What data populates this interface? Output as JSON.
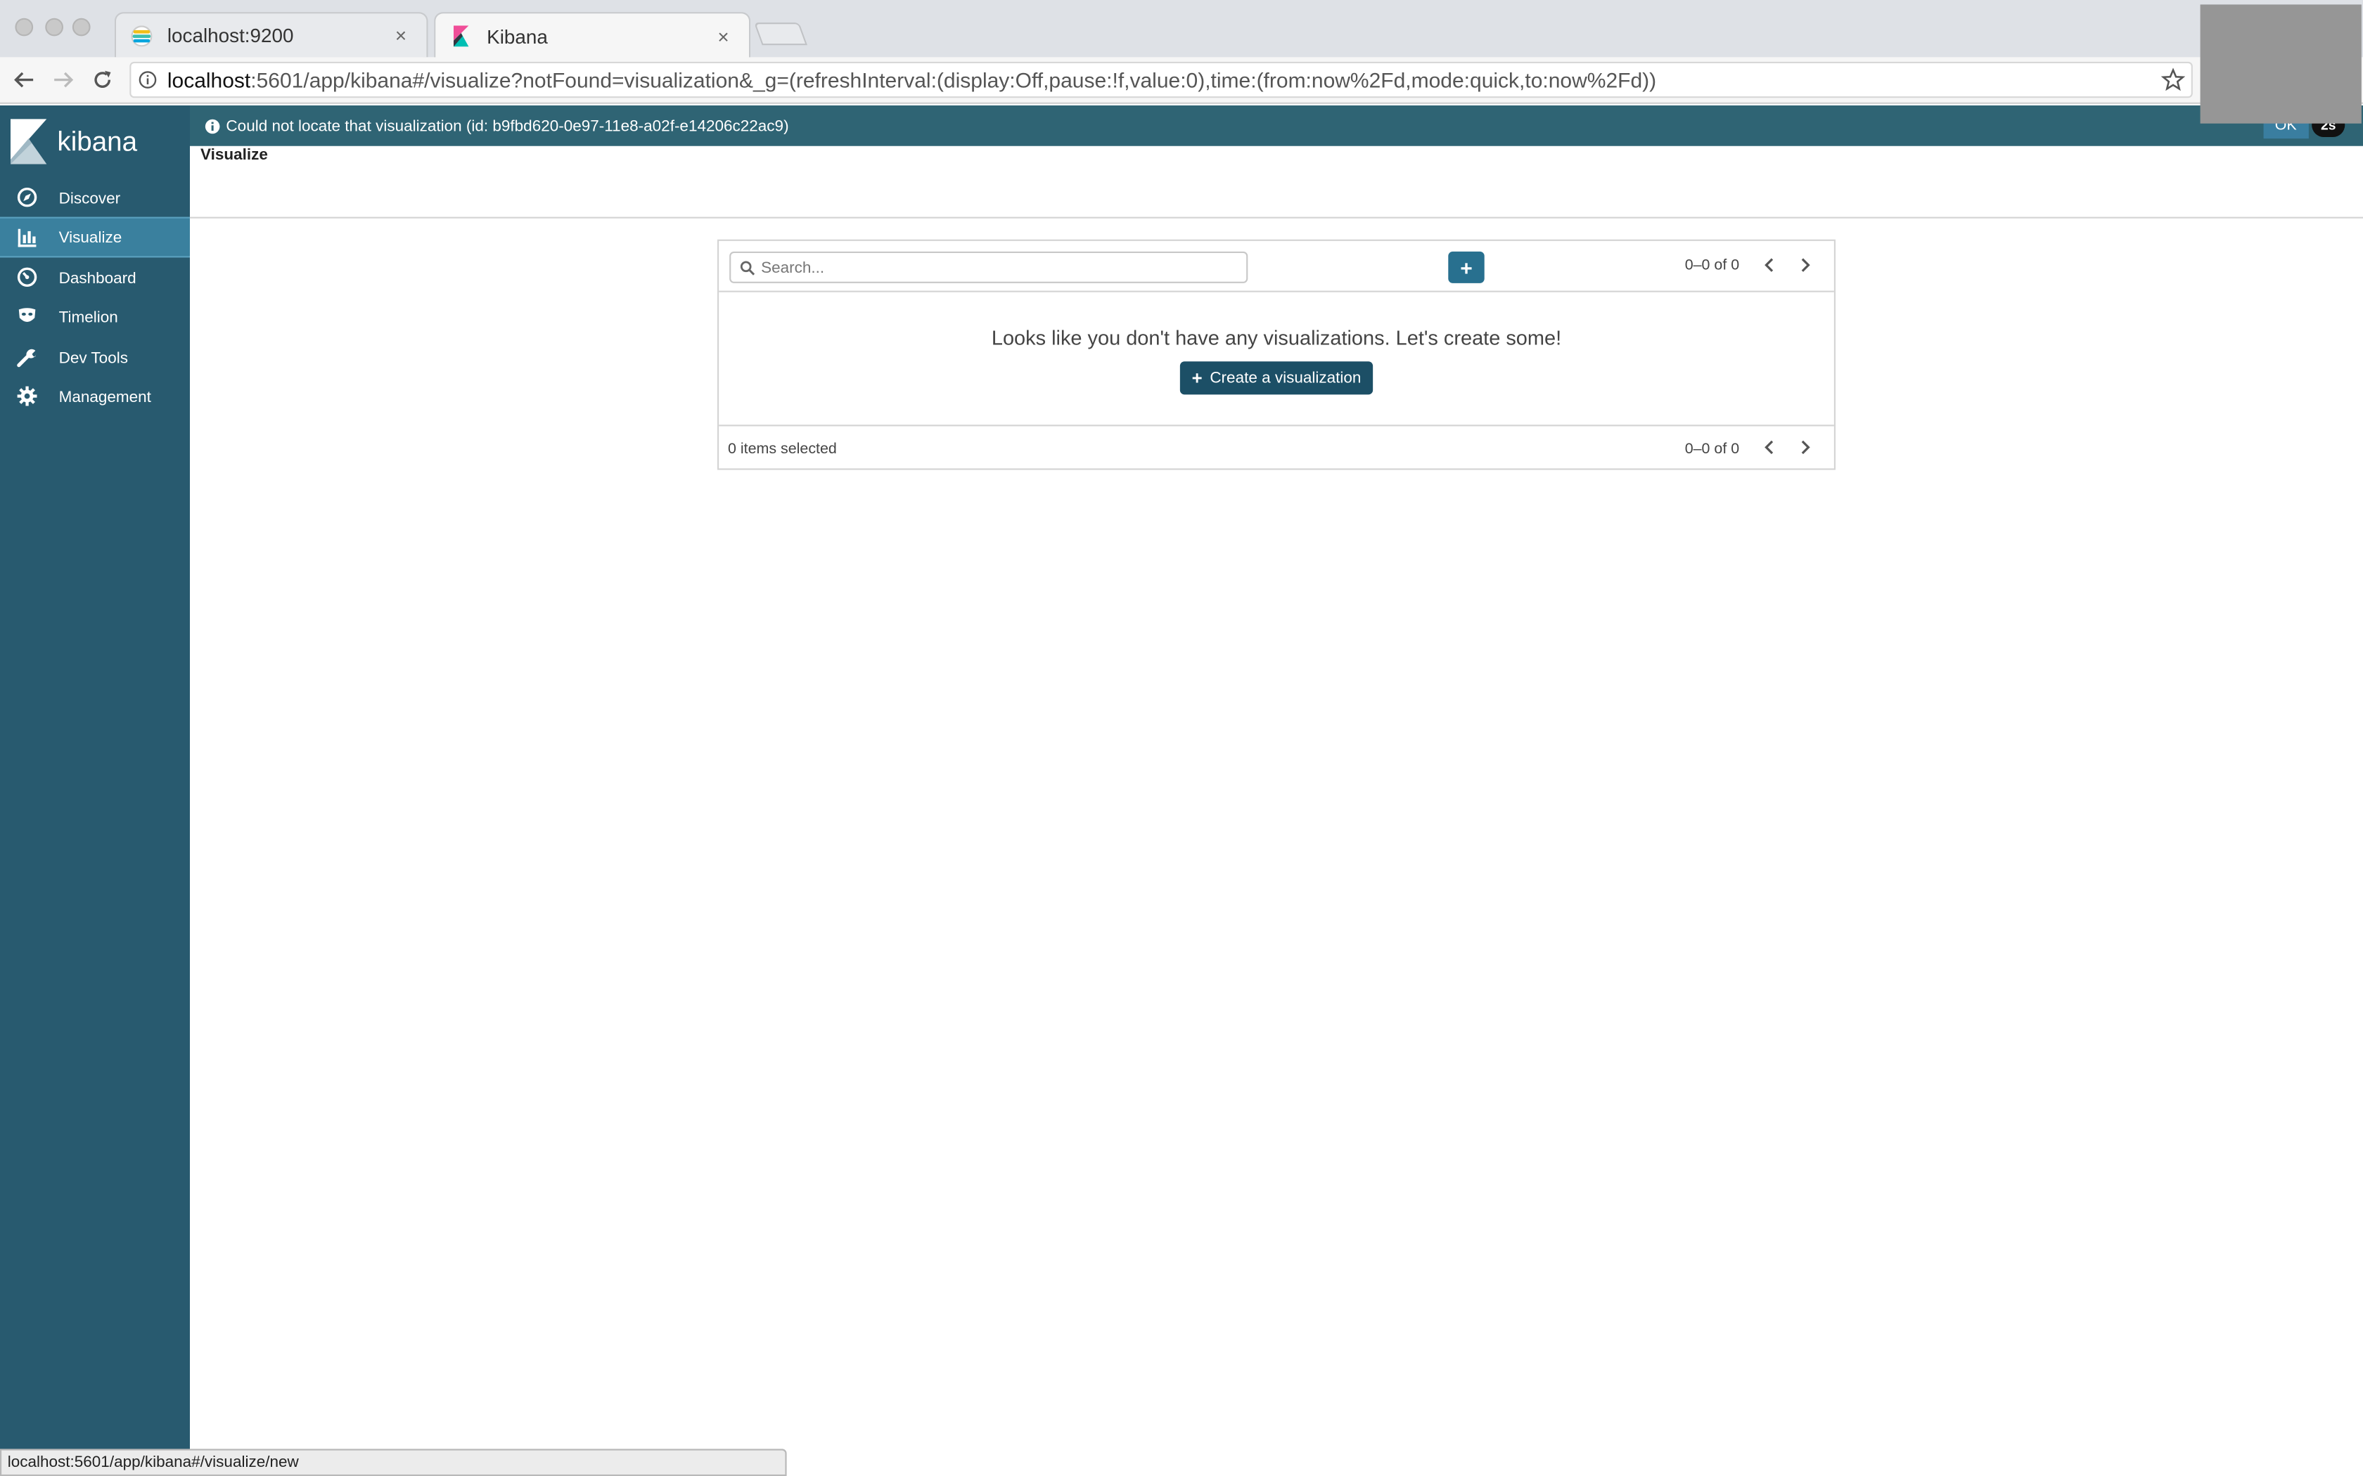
{
  "browser": {
    "tabs": [
      {
        "title": "localhost:9200",
        "close": "×",
        "favicon": "elasticsearch-favicon-icon"
      },
      {
        "title": "Kibana",
        "close": "×",
        "favicon": "kibana-favicon-icon"
      }
    ],
    "url": {
      "host": "localhost",
      "path": ":5601/app/kibana#/visualize?notFound=visualization&_g=(refreshInterval:(display:Off,pause:!f,value:0),time:(from:now%2Fd,mode:quick,to:now%2Fd))"
    },
    "status_url": "localhost:5601/app/kibana#/visualize/new"
  },
  "sidebar": {
    "logo_text": "kibana",
    "items": [
      {
        "label": "Discover",
        "icon": "compass-icon"
      },
      {
        "label": "Visualize",
        "icon": "bar-chart-icon",
        "active": true
      },
      {
        "label": "Dashboard",
        "icon": "dashboard-gauge-icon"
      },
      {
        "label": "Timelion",
        "icon": "timelion-mask-icon"
      },
      {
        "label": "Dev Tools",
        "icon": "wrench-icon"
      },
      {
        "label": "Management",
        "icon": "gear-icon"
      }
    ]
  },
  "notification": {
    "message": "Could not locate that visualization (id: b9fbd620-0e97-11e8-a02f-e14206c22ac9)",
    "ok_label": "OK",
    "count": "2s"
  },
  "page": {
    "title": "Visualize"
  },
  "list": {
    "search_placeholder": "Search...",
    "add_label": "+",
    "pager_top": "0–0 of 0",
    "empty_message": "Looks like you don't have any visualizations. Let's create some!",
    "create_label": "Create a visualization",
    "selected_text": "0 items selected",
    "pager_bottom": "0–0 of 0"
  },
  "colors": {
    "sidebar": "#285a6f",
    "notice": "#2f6474",
    "active_nav": "#3a809e",
    "primary_button": "#1c4f66"
  }
}
